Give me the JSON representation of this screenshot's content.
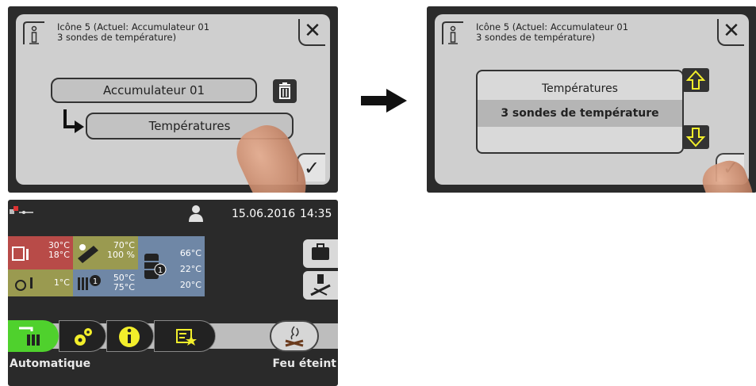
{
  "dialog1": {
    "title_line1": "Icône 5 (Actuel: Accumulateur 01",
    "title_line2": "3 sondes de température)",
    "top_pill": "Accumulateur 01",
    "bottom_pill": "Températures"
  },
  "dialog2": {
    "title_line1": "Icône 5 (Actuel: Accumulateur 01",
    "title_line2": "3 sondes de température)",
    "items": [
      "Températures",
      "3 sondes de température"
    ]
  },
  "home": {
    "date": "15.06.2016",
    "time": "14:35",
    "tiles": {
      "red_line1": "30°C",
      "red_line2": "18°C",
      "olive_line1": "70°C",
      "olive_line2": "100 %",
      "blue_line1": "66°C",
      "blue_line2": "22°C",
      "blue_line3": "20°C",
      "pump_value": "1°C",
      "heat_line1": "50°C",
      "heat_line2": "75°C"
    },
    "mode_left": "Automatique",
    "mode_right": "Feu éteint"
  },
  "icons": {
    "info": "info-icon",
    "close": "close-icon",
    "check": "check-icon",
    "trash": "trash-icon",
    "up": "arrow-up-icon",
    "down": "arrow-down-icon",
    "user": "user-icon",
    "network": "network-icon",
    "suitcase": "suitcase-icon",
    "chimney": "chimney-sweep-icon",
    "fire": "fire-icon"
  },
  "colors": {
    "dialog_bg": "#cfcfcf",
    "accent_yellow": "#f2ee2b",
    "tile_red": "#b84b48",
    "tile_olive": "#9a9a50",
    "tile_blue": "#6f87a6",
    "active_green": "#4fd12d"
  }
}
